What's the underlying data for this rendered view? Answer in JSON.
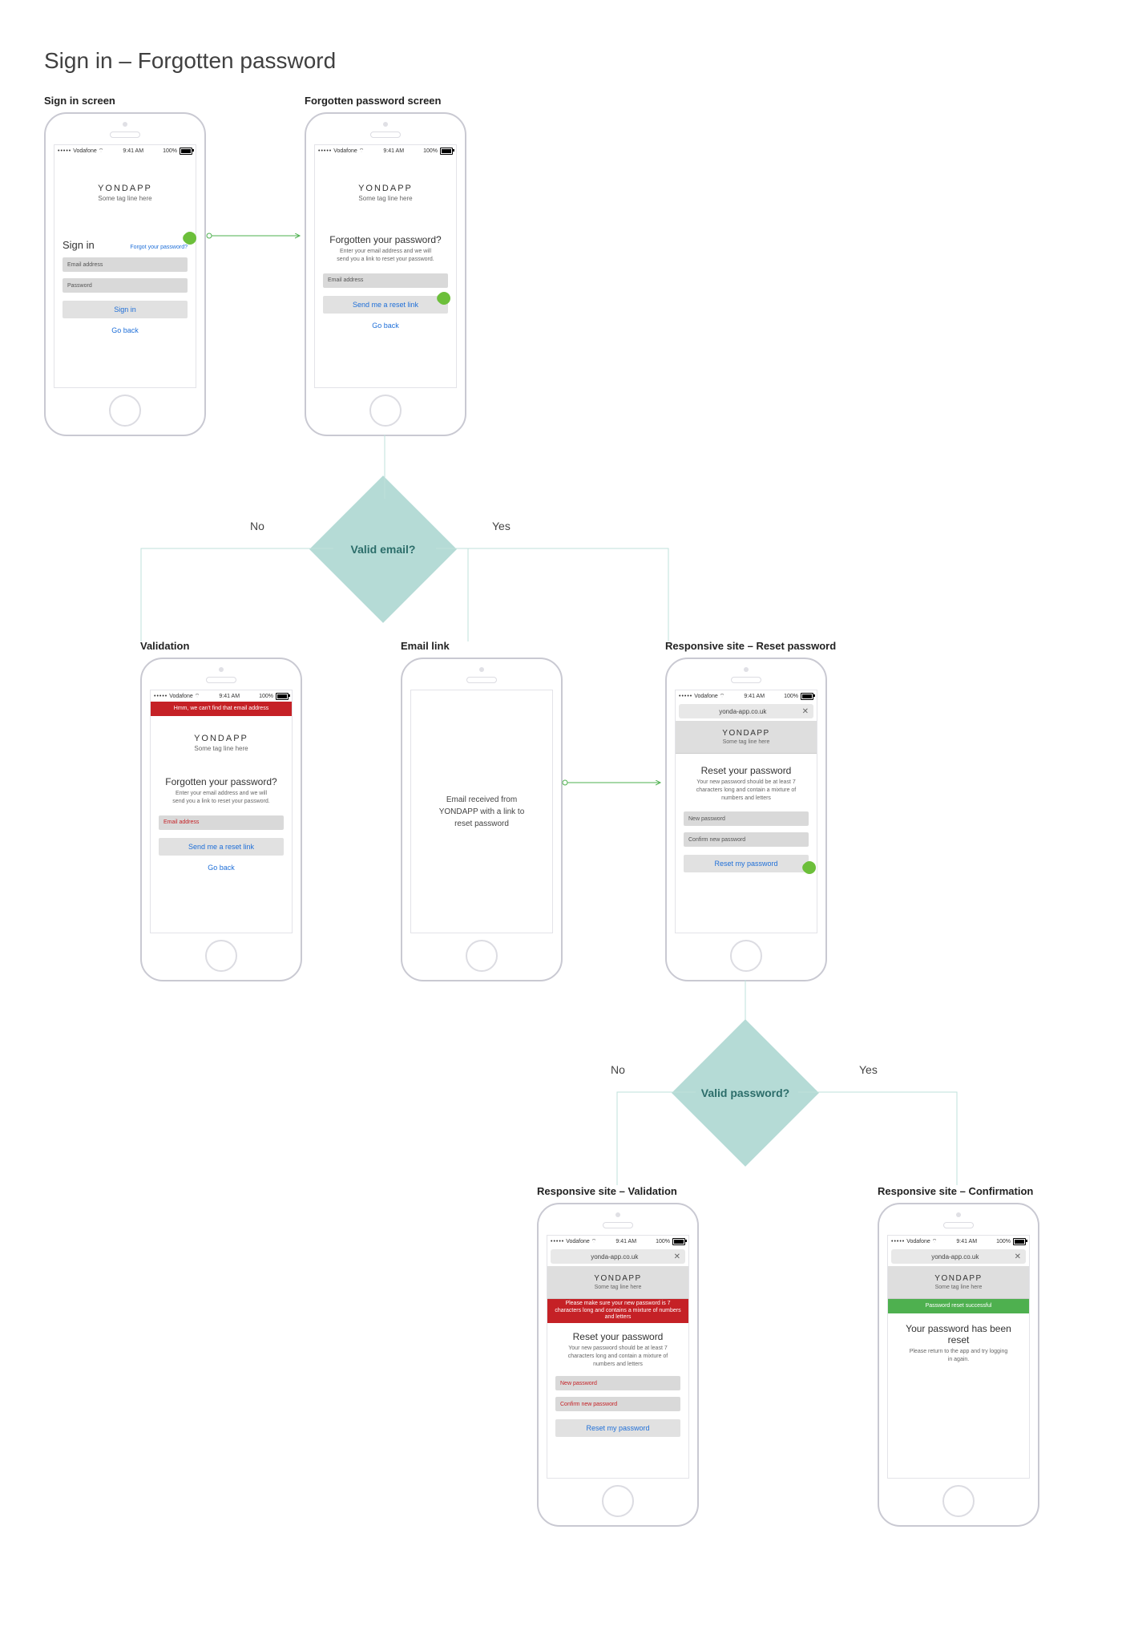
{
  "page": {
    "title": "Sign in – Forgotten password"
  },
  "status": {
    "carrier": "Vodafone",
    "signal": "•••••",
    "wifi": "⌔",
    "time": "9:41 AM",
    "battery": "100%"
  },
  "brand": {
    "name": "YONDAPP",
    "tagline": "Some tag line here"
  },
  "site_url": "yonda-app.co.uk",
  "decisions": {
    "d1": {
      "question": "Valid email?",
      "no": "No",
      "yes": "Yes"
    },
    "d2": {
      "question": "Valid password?",
      "no": "No",
      "yes": "Yes"
    }
  },
  "screens": {
    "signin": {
      "caption": "Sign in screen",
      "heading": "Sign in",
      "forgot_link": "Forgot your password?",
      "email_ph": "Email address",
      "pass_ph": "Password",
      "cta": "Sign in",
      "go_back": "Go back"
    },
    "forgot": {
      "caption": "Forgotten password screen",
      "heading": "Forgotten your password?",
      "sub": "Enter your email address and we will send you a link to reset your password.",
      "email_ph": "Email address",
      "cta": "Send me a reset link",
      "go_back": "Go back"
    },
    "validation_email": {
      "caption": "Validation",
      "banner": "Hmm, we can't find that email address",
      "heading": "Forgotten your password?",
      "sub": "Enter your email address and we will send you a link to reset your password.",
      "email_ph": "Email address",
      "cta": "Send me a reset link",
      "go_back": "Go back"
    },
    "email_link": {
      "caption": "Email link",
      "body": "Email received from YONDAPP with a link to reset password"
    },
    "reset": {
      "caption": "Responsive site – Reset password",
      "heading": "Reset your password",
      "sub": "Your new password should be at least 7 characters long and contain a mixture of numbers and letters",
      "new_ph": "New password",
      "confirm_ph": "Confirm new password",
      "cta": "Reset my password"
    },
    "reset_validation": {
      "caption": "Responsive site – Validation",
      "banner": "Please make sure your new password is 7 characters long and contains a mixture of numbers and letters",
      "heading": "Reset your password",
      "sub": "Your new password should be at least 7 characters long and contain a mixture of numbers and letters",
      "new_ph": "New password",
      "confirm_ph": "Confirm new password",
      "cta": "Reset my password"
    },
    "confirmation": {
      "caption": "Responsive site – Confirmation",
      "banner": "Password reset successful",
      "heading": "Your password has been reset",
      "sub": "Please return to the app and try logging in again."
    }
  }
}
